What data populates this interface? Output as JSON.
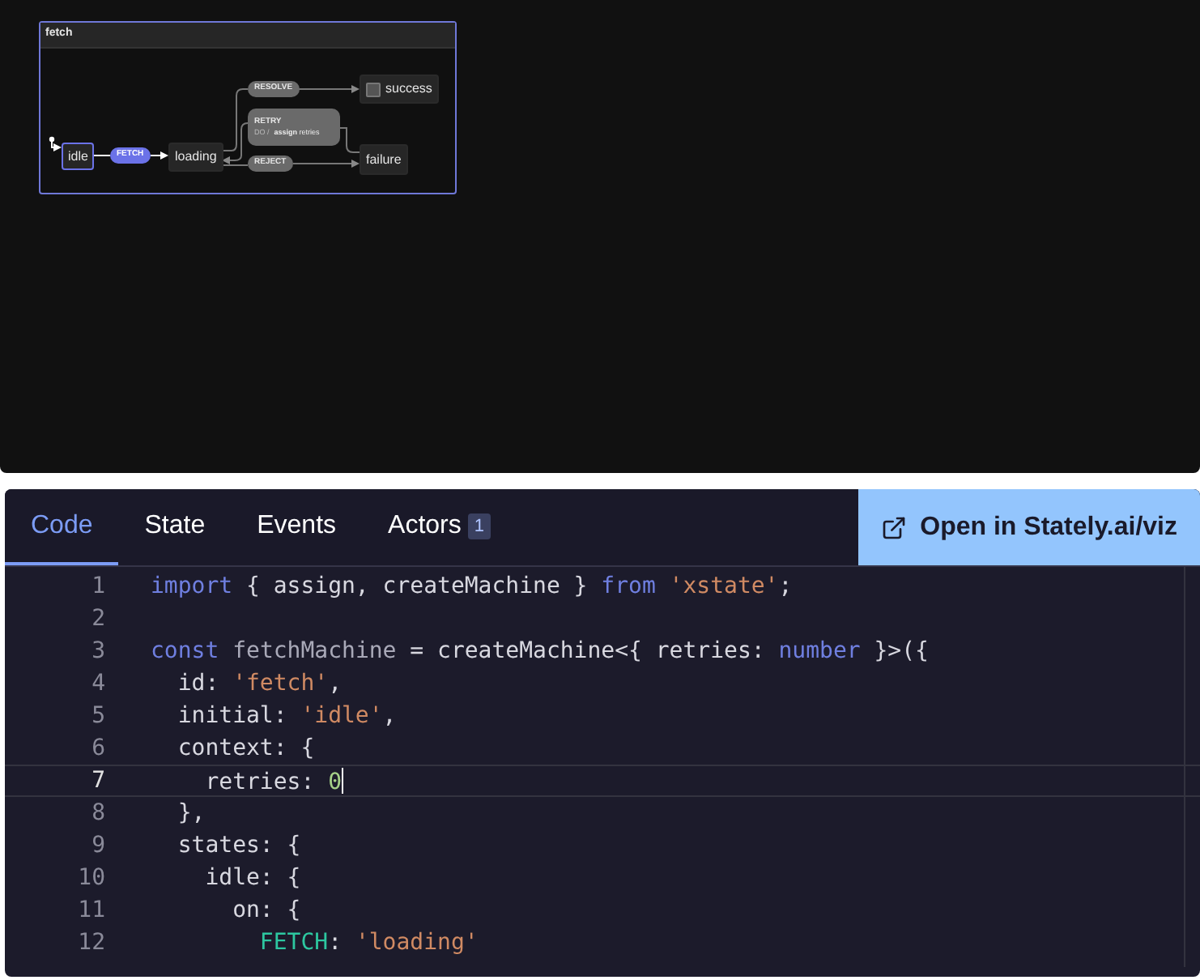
{
  "diagram": {
    "machine_title": "fetch",
    "nodes": [
      {
        "label": "idle",
        "kind": "state",
        "active": true
      },
      {
        "label": "loading",
        "kind": "state",
        "active": false
      },
      {
        "label": "success",
        "kind": "final",
        "active": false
      },
      {
        "label": "failure",
        "kind": "state",
        "active": false
      }
    ],
    "events": [
      {
        "label": "FETCH",
        "enabled": true
      },
      {
        "label": "RESOLVE",
        "enabled": false
      },
      {
        "label": "REJECT",
        "enabled": false
      }
    ],
    "retry": {
      "label": "RETRY",
      "action_prefix": "DO /",
      "action": "assign",
      "action_arg": "retries"
    }
  },
  "tabs": [
    {
      "label": "Code",
      "selected": true
    },
    {
      "label": "State",
      "selected": false
    },
    {
      "label": "Events",
      "selected": false
    },
    {
      "label": "Actors",
      "selected": false,
      "badge": "1"
    }
  ],
  "open_button": "Open in Stately.ai/viz",
  "code_lines": [
    {
      "number": "1",
      "current": false,
      "tokens": [
        {
          "kind": "keyword",
          "text": "import"
        },
        {
          "kind": "plain",
          "text": " { assign, createMachine } "
        },
        {
          "kind": "keyword",
          "text": "from"
        },
        {
          "kind": "string",
          "text": " 'xstate'"
        },
        {
          "kind": "plain",
          "text": ";"
        }
      ]
    },
    {
      "number": "2",
      "current": false
    },
    {
      "number": "3",
      "current": false,
      "tokens": [
        {
          "kind": "keyword",
          "text": "const"
        },
        {
          "kind": "variable",
          "text": " fetchMachine"
        },
        {
          "kind": "plain",
          "text": " = createMachine<{ retries: "
        },
        {
          "kind": "keyword",
          "text": "number"
        },
        {
          "kind": "plain",
          "text": " }>({"
        }
      ]
    },
    {
      "number": "4",
      "current": false,
      "tokens": [
        {
          "kind": "plain",
          "text": "  id: "
        },
        {
          "kind": "string",
          "text": "'fetch'"
        },
        {
          "kind": "plain",
          "text": ","
        }
      ]
    },
    {
      "number": "5",
      "current": false,
      "tokens": [
        {
          "kind": "plain",
          "text": "  initial: "
        },
        {
          "kind": "string",
          "text": "'idle'"
        },
        {
          "kind": "plain",
          "text": ","
        }
      ]
    },
    {
      "number": "6",
      "current": false,
      "tokens": [
        {
          "kind": "plain",
          "text": "  context: {"
        }
      ]
    },
    {
      "number": "7",
      "current": true,
      "tokens": [
        {
          "kind": "plain",
          "text": "    retries: "
        },
        {
          "kind": "number",
          "text": "0"
        }
      ]
    },
    {
      "number": "8",
      "current": false,
      "tokens": [
        {
          "kind": "plain",
          "text": "  },"
        }
      ]
    },
    {
      "number": "9",
      "current": false,
      "tokens": [
        {
          "kind": "plain",
          "text": "  states: {"
        }
      ]
    },
    {
      "number": "10",
      "current": false,
      "tokens": [
        {
          "kind": "plain",
          "text": "    idle: {"
        }
      ]
    },
    {
      "number": "11",
      "current": false,
      "tokens": [
        {
          "kind": "plain",
          "text": "      on: {"
        }
      ]
    },
    {
      "number": "12",
      "current": false,
      "tokens": [
        {
          "kind": "event",
          "text": "        FETCH"
        },
        {
          "kind": "plain",
          "text": ": "
        },
        {
          "kind": "string",
          "text": "'loading'"
        }
      ]
    }
  ]
}
